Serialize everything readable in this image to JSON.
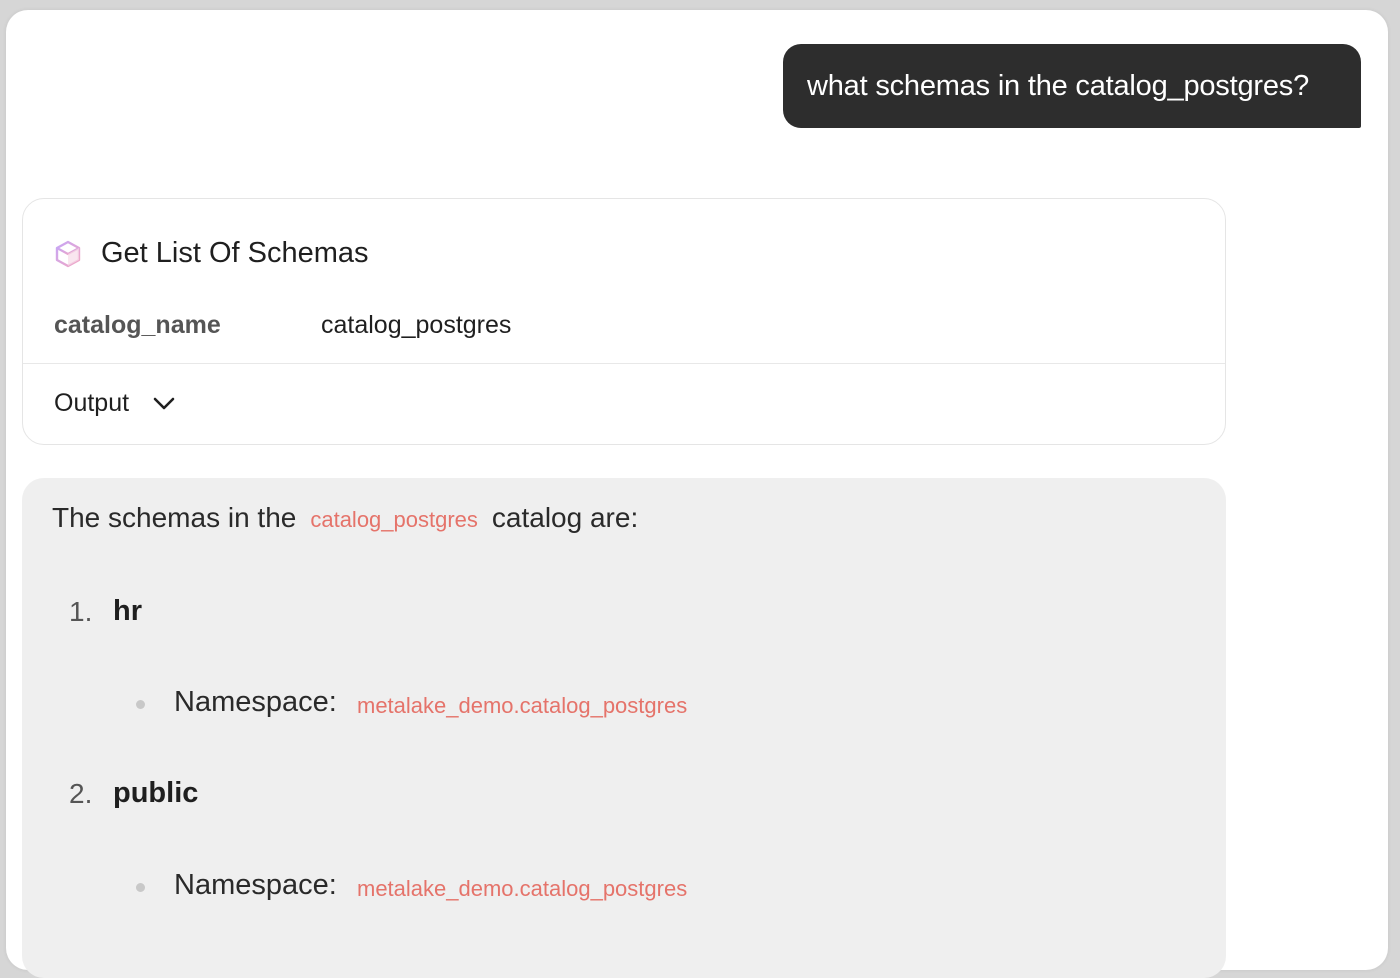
{
  "user_message": "what schemas in the catalog_postgres?",
  "tool_call": {
    "title": "Get List Of Schemas",
    "icon": "cube-icon",
    "params": [
      {
        "key": "catalog_name",
        "value": "catalog_postgres"
      }
    ],
    "output_label": "Output"
  },
  "answer": {
    "intro_before": "The schemas in the",
    "intro_code": "catalog_postgres",
    "intro_after": "catalog are:",
    "items": [
      {
        "number": "1.",
        "name": "hr",
        "namespace_label": "Namespace:",
        "namespace_value": "metalake_demo.catalog_postgres"
      },
      {
        "number": "2.",
        "name": "public",
        "namespace_label": "Namespace:",
        "namespace_value": "metalake_demo.catalog_postgres"
      }
    ]
  },
  "colors": {
    "user_bubble": "#2d2d2d",
    "code_text": "#e5736a",
    "answer_bg": "#efefef"
  }
}
